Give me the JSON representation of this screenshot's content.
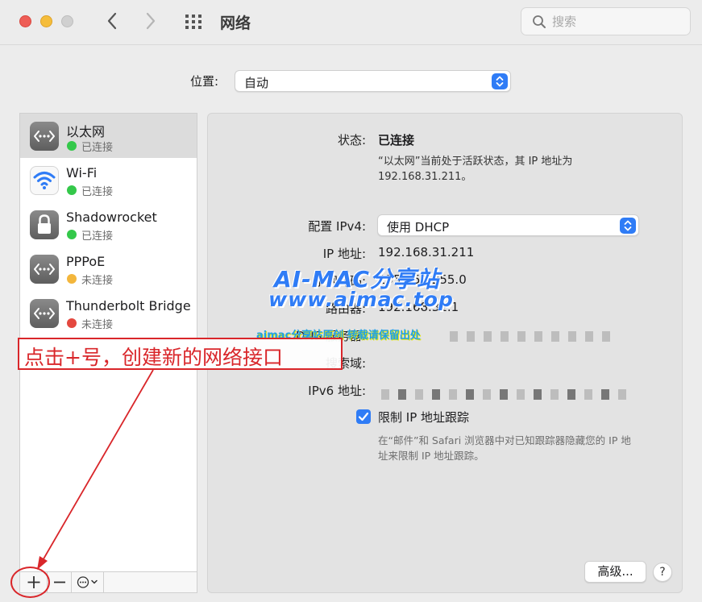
{
  "window": {
    "title": "网络",
    "search_placeholder": "搜索"
  },
  "location": {
    "label": "位置:",
    "value": "自动"
  },
  "services": [
    {
      "name": "以太网",
      "status": "已连接",
      "status_color": "#34c84a",
      "icon": "ethernet-icon",
      "selected": true
    },
    {
      "name": "Wi-Fi",
      "status": "已连接",
      "status_color": "#34c84a",
      "icon": "wifi-icon",
      "selected": false
    },
    {
      "name": "Shadowrocket",
      "status": "已连接",
      "status_color": "#34c84a",
      "icon": "lock-icon",
      "selected": false
    },
    {
      "name": "PPPoE",
      "status": "未连接",
      "status_color": "#f3b63c",
      "icon": "ethernet-icon",
      "selected": false
    },
    {
      "name": "Thunderbolt Bridge",
      "status": "未连接",
      "status_color": "#e4483f",
      "icon": "ethernet-icon",
      "selected": false
    }
  ],
  "sidebar_toolbar": {
    "add": "+",
    "remove": "−"
  },
  "detail": {
    "status_label": "状态:",
    "status_value": "已连接",
    "status_desc_line1": "“以太网”当前处于活跃状态，其 IP 地址为",
    "status_desc_line2": "192.168.31.211。",
    "ipv4_label": "配置 IPv4:",
    "ipv4_value": "使用 DHCP",
    "ip_label": "IP 地址:",
    "ip_value": "192.168.31.211",
    "subnet_label": "子网掩码:",
    "subnet_value": "255.255.255.0",
    "router_label": "路由器:",
    "router_value": "192.168.31.1",
    "dns_label": "DNS 服务器:",
    "search_domain_label": "搜索域:",
    "ipv6_label": "IPv6 地址:",
    "limit_ip_label": "限制 IP 地址跟踪",
    "limit_ip_desc_line1": "在“邮件”和 Safari 浏览器中对已知跟踪器隐藏您的 IP 地",
    "limit_ip_desc_line2": "址来限制 IP 地址跟踪。",
    "advanced_button": "高级...",
    "help_button": "?"
  },
  "watermark": {
    "line1": "AI-MAC分享站",
    "line2": "www.aimac.top",
    "line3": "aimac分享站原创 转载请保留出处"
  },
  "annotation": {
    "text": "点击+号，创建新的网络接口"
  },
  "colors": {
    "accent": "#2f7cf6",
    "annotation": "#d9262a"
  }
}
